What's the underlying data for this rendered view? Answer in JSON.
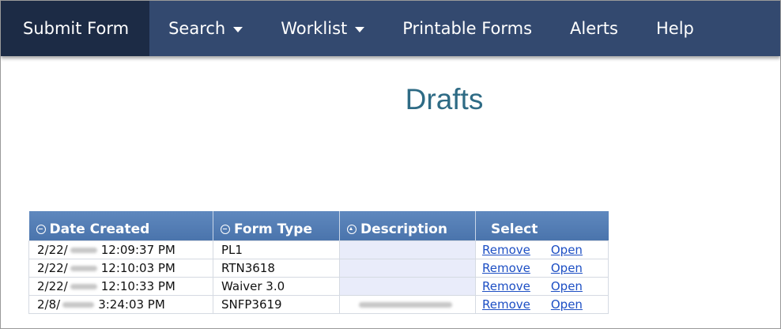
{
  "nav": {
    "items": [
      {
        "label": "Submit Form",
        "active": true
      },
      {
        "label": "Search",
        "dropdown": true
      },
      {
        "label": "Worklist",
        "dropdown": true
      },
      {
        "label": "Printable Forms"
      },
      {
        "label": "Alerts"
      },
      {
        "label": "Help"
      }
    ]
  },
  "page": {
    "title": "Drafts"
  },
  "table": {
    "columns": [
      "Date Created",
      "Form Type",
      "Description",
      "Select"
    ],
    "rows": [
      {
        "date_prefix": "2/22/",
        "time": "12:09:37 PM",
        "form_type": "PL1",
        "description": "",
        "remove": "Remove",
        "open": "Open"
      },
      {
        "date_prefix": "2/22/",
        "time": "12:10:03 PM",
        "form_type": "RTN3618",
        "description": "",
        "remove": "Remove",
        "open": "Open"
      },
      {
        "date_prefix": "2/22/",
        "time": "12:10:33 PM",
        "form_type": "Waiver 3.0",
        "description": "",
        "remove": "Remove",
        "open": "Open"
      },
      {
        "date_prefix": "2/8/",
        "time": "3:24:03 PM",
        "form_type": "SNFP3619",
        "description": "",
        "remove": "Remove",
        "open": "Open"
      }
    ]
  },
  "colors": {
    "nav_bg": "#33496f",
    "nav_active_bg": "#1c2b45",
    "title": "#2e6b85",
    "table_header": "#5579b2",
    "link": "#1d4fc4",
    "description_cell_bg": "#e9ecfa"
  }
}
